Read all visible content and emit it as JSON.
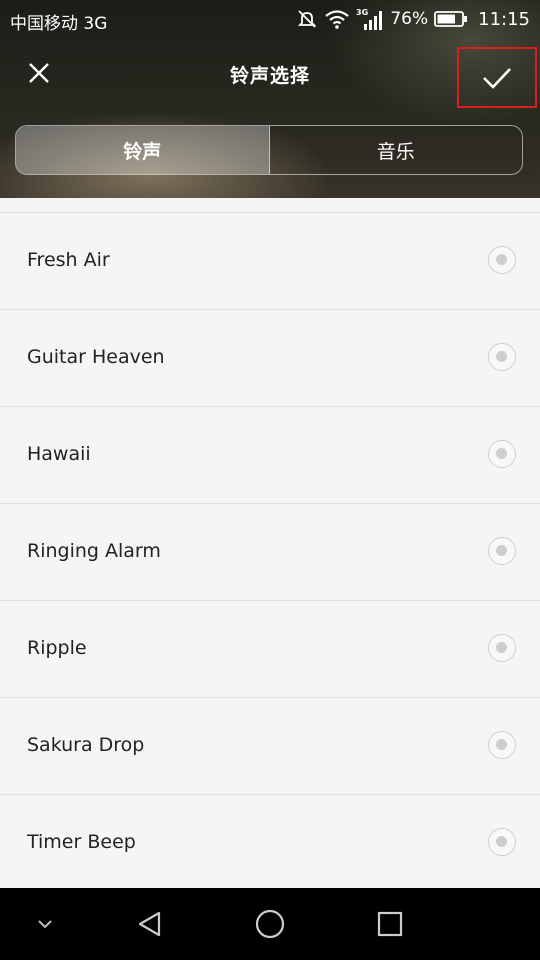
{
  "status_bar": {
    "carrier": "中国移动 3G",
    "network_tag": "3G",
    "battery_percent": "76%",
    "battery_level": 0.76,
    "time": "11:15"
  },
  "app_bar": {
    "title": "铃声选择",
    "close_icon": "close-icon",
    "confirm_icon": "check-icon"
  },
  "tabs": [
    {
      "label": "铃声",
      "active": true
    },
    {
      "label": "音乐",
      "active": false
    }
  ],
  "ringtones": [
    {
      "name": "Fresh Air",
      "selected": false
    },
    {
      "name": "Guitar Heaven",
      "selected": false
    },
    {
      "name": "Hawaii",
      "selected": false
    },
    {
      "name": "Ringing Alarm",
      "selected": false
    },
    {
      "name": "Ripple",
      "selected": false
    },
    {
      "name": "Sakura Drop",
      "selected": false
    },
    {
      "name": "Timer Beep",
      "selected": false
    }
  ],
  "nav_bar": {
    "items": [
      "hide-keyboard-icon",
      "back-icon",
      "home-icon",
      "recents-icon"
    ]
  },
  "colors": {
    "highlight_border": "#d9201f",
    "list_background": "#f5f5f5",
    "divider": "#e1e1e1"
  }
}
